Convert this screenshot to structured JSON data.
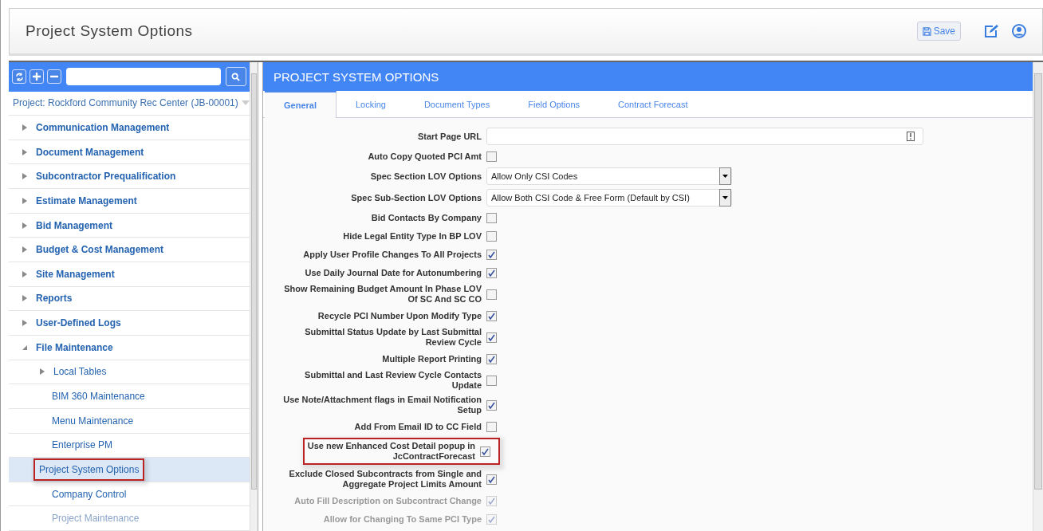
{
  "header": {
    "title": "Project System Options",
    "save_button": "Save"
  },
  "sidebar": {
    "project": "Project: Rockford Community Rec Center (JB-00001)",
    "items": [
      {
        "label": "Communication Management",
        "kind": "group",
        "expanded": false,
        "selected": false,
        "highlighted": false,
        "disabled": false
      },
      {
        "label": "Document Management",
        "kind": "group",
        "expanded": false,
        "selected": false,
        "highlighted": false,
        "disabled": false
      },
      {
        "label": "Subcontractor Prequalification",
        "kind": "group",
        "expanded": false,
        "selected": false,
        "highlighted": false,
        "disabled": false
      },
      {
        "label": "Estimate Management",
        "kind": "group",
        "expanded": false,
        "selected": false,
        "highlighted": false,
        "disabled": false
      },
      {
        "label": "Bid Management",
        "kind": "group",
        "expanded": false,
        "selected": false,
        "highlighted": false,
        "disabled": false
      },
      {
        "label": "Budget & Cost Management",
        "kind": "group",
        "expanded": false,
        "selected": false,
        "highlighted": false,
        "disabled": false
      },
      {
        "label": "Site Management",
        "kind": "group",
        "expanded": false,
        "selected": false,
        "highlighted": false,
        "disabled": false
      },
      {
        "label": "Reports",
        "kind": "group",
        "expanded": false,
        "selected": false,
        "highlighted": false,
        "disabled": false
      },
      {
        "label": "User-Defined Logs",
        "kind": "group",
        "expanded": false,
        "selected": false,
        "highlighted": false,
        "disabled": false
      },
      {
        "label": "File Maintenance",
        "kind": "group",
        "expanded": true,
        "selected": false,
        "highlighted": false,
        "disabled": false,
        "children": [
          {
            "label": "Local Tables",
            "kind": "group",
            "expanded": false,
            "selected": false,
            "highlighted": false,
            "disabled": false
          },
          {
            "label": "BIM 360 Maintenance",
            "kind": "page",
            "selected": false,
            "highlighted": false,
            "disabled": false
          },
          {
            "label": "Menu Maintenance",
            "kind": "page",
            "selected": false,
            "highlighted": false,
            "disabled": false
          },
          {
            "label": "Enterprise PM",
            "kind": "page",
            "selected": false,
            "highlighted": false,
            "disabled": false
          },
          {
            "label": "Project System Options",
            "kind": "page",
            "selected": true,
            "highlighted": true,
            "disabled": false
          },
          {
            "label": "Company Control",
            "kind": "page",
            "selected": false,
            "highlighted": false,
            "disabled": false
          },
          {
            "label": "Project Maintenance",
            "kind": "page",
            "selected": false,
            "highlighted": false,
            "disabled": true
          }
        ]
      }
    ]
  },
  "panel": {
    "title": "PROJECT SYSTEM OPTIONS",
    "tabs": [
      {
        "label": "General",
        "selected": true
      },
      {
        "label": "Locking",
        "selected": false
      },
      {
        "label": "Document Types",
        "selected": false
      },
      {
        "label": "Field Options",
        "selected": false
      },
      {
        "label": "Contract Forecast",
        "selected": false
      }
    ],
    "fields": [
      {
        "kind": "text",
        "label": "Start Page URL"
      },
      {
        "kind": "checkbox",
        "label": "Auto Copy Quoted PCI Amt",
        "checked": false,
        "disabled": false,
        "highlighted": false
      },
      {
        "kind": "select",
        "label": "Spec Section LOV Options",
        "value": "Allow Only CSI Codes"
      },
      {
        "kind": "select",
        "label": "Spec Sub-Section LOV Options",
        "value": "Allow Both CSI Code & Free Form (Default by CSI)"
      },
      {
        "kind": "checkbox",
        "label": "Bid Contacts By Company",
        "checked": false,
        "disabled": false,
        "highlighted": false
      },
      {
        "kind": "checkbox",
        "label": "Hide Legal Entity Type In BP LOV",
        "checked": false,
        "disabled": false,
        "highlighted": false
      },
      {
        "kind": "checkbox",
        "label": "Apply User Profile Changes To All Projects",
        "checked": true,
        "disabled": false,
        "highlighted": false
      },
      {
        "kind": "checkbox",
        "label": "Use Daily Journal Date for Autonumbering",
        "checked": true,
        "disabled": false,
        "highlighted": false
      },
      {
        "kind": "checkbox",
        "label": "Show Remaining Budget Amount In Phase LOV Of SC And SC CO",
        "checked": false,
        "disabled": false,
        "highlighted": false
      },
      {
        "kind": "checkbox",
        "label": "Recycle PCI Number Upon Modify Type",
        "checked": true,
        "disabled": false,
        "highlighted": false
      },
      {
        "kind": "checkbox",
        "label": "Submittal Status Update by Last Submittal Review Cycle",
        "checked": true,
        "disabled": false,
        "highlighted": false
      },
      {
        "kind": "checkbox",
        "label": "Multiple Report Printing",
        "checked": true,
        "disabled": false,
        "highlighted": false
      },
      {
        "kind": "checkbox",
        "label": "Submittal and Last Review Cycle Contacts Update",
        "checked": false,
        "disabled": false,
        "highlighted": false
      },
      {
        "kind": "checkbox",
        "label": "Use Note/Attachment flags in Email Notification Setup",
        "checked": true,
        "disabled": false,
        "highlighted": false
      },
      {
        "kind": "checkbox",
        "label": "Add From Email ID to CC Field",
        "checked": false,
        "disabled": false,
        "highlighted": false
      },
      {
        "kind": "checkbox",
        "label": "Use new Enhanced Cost Detail popup in JcContractForecast",
        "checked": true,
        "disabled": false,
        "highlighted": true
      },
      {
        "kind": "checkbox",
        "label": "Exclude Closed Subcontracts from Single and Aggregate Project Limits Amount",
        "checked": true,
        "disabled": false,
        "highlighted": false
      },
      {
        "kind": "checkbox",
        "label": "Auto Fill Description on Subcontract Change",
        "checked": true,
        "disabled": true,
        "highlighted": false
      },
      {
        "kind": "checkbox",
        "label": "Allow for Changing To Same PCI Type",
        "checked": true,
        "disabled": true,
        "highlighted": false
      }
    ]
  }
}
